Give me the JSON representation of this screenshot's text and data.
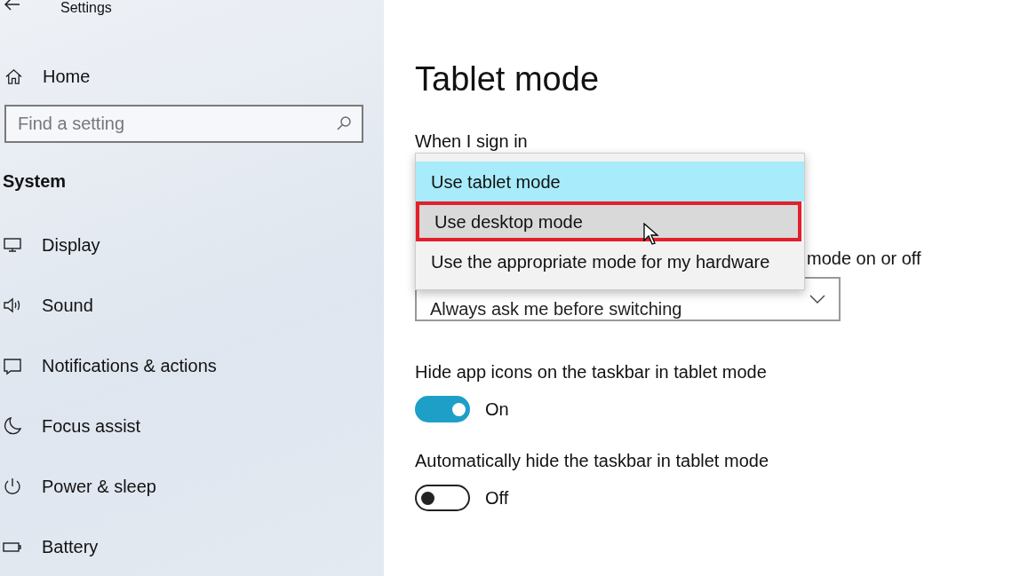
{
  "window": {
    "title": "Settings"
  },
  "sidebar": {
    "home": "Home",
    "search": {
      "placeholder": "Find a setting"
    },
    "section": "System",
    "items": [
      {
        "label": "Display",
        "kind": "display"
      },
      {
        "label": "Sound",
        "kind": "sound"
      },
      {
        "label": "Notifications & actions",
        "kind": "notifications"
      },
      {
        "label": "Focus assist",
        "kind": "focus"
      },
      {
        "label": "Power & sleep",
        "kind": "power"
      },
      {
        "label": "Battery",
        "kind": "battery"
      }
    ]
  },
  "page": {
    "title": "Tablet mode",
    "sign_in": {
      "label": "When I sign in",
      "menu": [
        {
          "label": "Use tablet mode",
          "selected": true,
          "hovered": false,
          "outlined": false
        },
        {
          "label": "Use desktop mode",
          "selected": false,
          "hovered": true,
          "outlined": true
        },
        {
          "label": "Use the appropriate mode for my hardware",
          "selected": false,
          "hovered": false,
          "outlined": false
        }
      ]
    },
    "switching": {
      "label": "mode on or off",
      "value": "Always ask me before switching"
    },
    "toggles": [
      {
        "label": "Hide app icons on the taskbar in tablet mode",
        "on": true,
        "state_text": "On"
      },
      {
        "label": "Automatically hide the taskbar in tablet mode",
        "on": false,
        "state_text": "Off"
      }
    ]
  }
}
